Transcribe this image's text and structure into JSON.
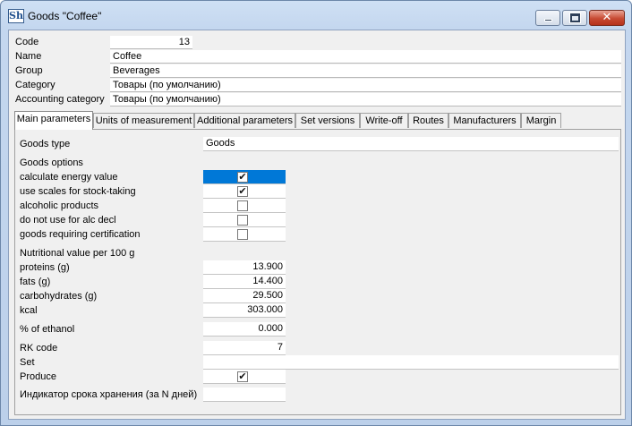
{
  "window": {
    "title": "Goods \"Coffee\"",
    "app_icon": "Sh"
  },
  "header": {
    "code_label": "Code",
    "code_value": "13",
    "name_label": "Name",
    "name_value": "Coffee",
    "group_label": "Group",
    "group_value": "Beverages",
    "category_label": "Category",
    "category_value": "Товары (по умолчанию)",
    "acc_category_label": "Accounting category",
    "acc_category_value": "Товары (по умолчанию)"
  },
  "tabs": [
    {
      "label": "Main parameters",
      "active": true
    },
    {
      "label": "Units of measurement"
    },
    {
      "label": "Additional parameters"
    },
    {
      "label": "Set versions"
    },
    {
      "label": "Write-off"
    },
    {
      "label": "Routes"
    },
    {
      "label": "Manufacturers"
    },
    {
      "label": "Margin"
    }
  ],
  "main": {
    "goods_type_label": "Goods type",
    "goods_type_value": "Goods",
    "goods_options_label": "Goods options",
    "options": [
      {
        "label": "calculate energy value",
        "checked": true,
        "selected": true,
        "mark": "✔"
      },
      {
        "label": "use scales for stock-taking",
        "checked": true,
        "mark": "✔"
      },
      {
        "label": "alcoholic products",
        "checked": false,
        "mark": ""
      },
      {
        "label": "do not use for alc decl",
        "checked": false,
        "mark": ""
      },
      {
        "label": "goods requiring certification",
        "checked": false,
        "mark": ""
      }
    ],
    "nutrition_label": "Nutritional value per 100 g",
    "nutrition": [
      {
        "label": "proteins (g)",
        "value": "13.900"
      },
      {
        "label": "fats (g)",
        "value": "14.400"
      },
      {
        "label": "carbohydrates (g)",
        "value": "29.500"
      },
      {
        "label": "kcal",
        "value": "303.000"
      }
    ],
    "ethanol_label": "% of ethanol",
    "ethanol_value": "0.000",
    "rk_code_label": "RK code",
    "rk_code_value": "7",
    "set_label": "Set",
    "set_value": "",
    "produce_label": "Produce",
    "produce_checked": true,
    "produce_mark": "✔",
    "shelf_life_label": "Индикатор срока хранения (за N дней)",
    "shelf_life_value": ""
  },
  "colors": {
    "selection": "#0078d7",
    "close_button": "#c74a33"
  }
}
